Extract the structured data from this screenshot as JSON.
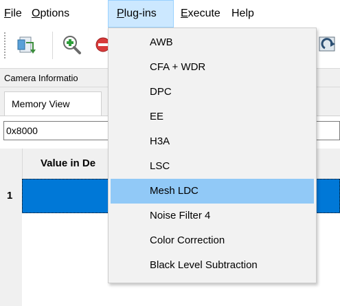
{
  "menubar": {
    "items": [
      {
        "label": "File",
        "mnemonic": "F",
        "rest": "ile"
      },
      {
        "label": "Options",
        "mnemonic": "O",
        "rest": "ptions"
      },
      {
        "label": "Plug-ins",
        "mnemonic": "P",
        "rest": "lug-ins",
        "active": true
      },
      {
        "label": "Execute",
        "mnemonic": "E",
        "rest": "xecute"
      },
      {
        "label": "Help",
        "mnemonic": "",
        "rest": "Help"
      }
    ]
  },
  "toolbar": {
    "icons": [
      "document-icon",
      "zoom-in-icon",
      "remove-icon",
      "refresh-icon"
    ]
  },
  "panel": {
    "title": "Camera Informatio"
  },
  "tabs": {
    "active": "Memory View"
  },
  "address": {
    "value": "0x8000"
  },
  "grid": {
    "column_header": "Value in De",
    "rows": [
      {
        "num": "1",
        "selected": true
      }
    ]
  },
  "plugins_menu": {
    "items": [
      {
        "label": "AWB"
      },
      {
        "label": "CFA + WDR"
      },
      {
        "label": "DPC"
      },
      {
        "label": "EE"
      },
      {
        "label": "H3A"
      },
      {
        "label": "LSC"
      },
      {
        "label": "Mesh LDC",
        "hover": true
      },
      {
        "label": "Noise Filter 4"
      },
      {
        "label": "Color Correction"
      },
      {
        "label": "Black Level Subtraction"
      }
    ]
  },
  "colors": {
    "selection": "#0078d7",
    "menu_hover": "#91c9f7",
    "menubar_active": "#cce8ff"
  }
}
